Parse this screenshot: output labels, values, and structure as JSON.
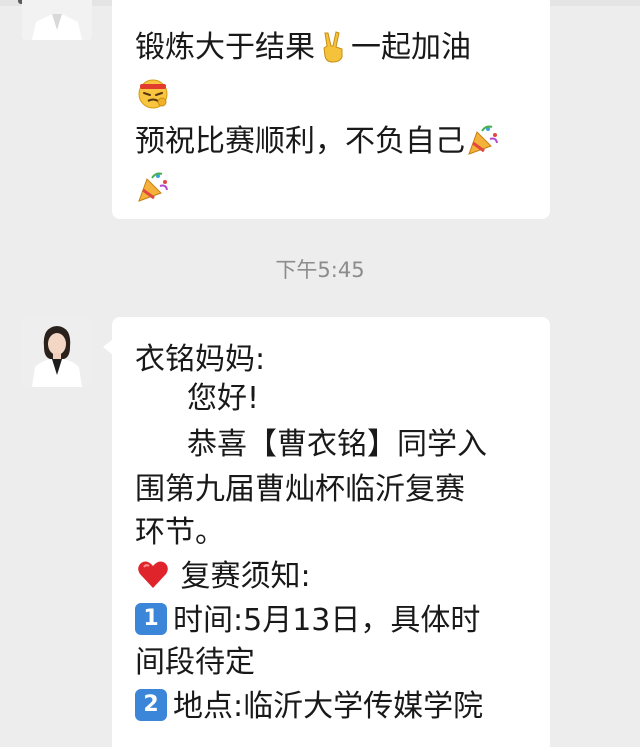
{
  "messages": [
    {
      "sender": "other",
      "lines": {
        "l1_text": "锻炼大于结果",
        "l1_emoji": "victory-hand-emoji",
        "l1_text2": "一起加油",
        "l2_emoji": "determined-face-headband-emoji",
        "l3_text": "预祝比赛顺利，不负自己",
        "l3_emoji": "party-popper-emoji",
        "l4_emoji": "party-popper-emoji"
      }
    }
  ],
  "timestamp": "下午5:45",
  "message2": {
    "greeting": "衣铭妈妈:",
    "hello": "您好!",
    "congrats_line1": "恭喜【曹衣铭】同学入",
    "congrats_line2": "围第九届曹灿杯临沂复赛",
    "congrats_line3": "环节。",
    "notice_icon": "red-heart-emoji",
    "notice_title": "复赛须知:",
    "item1_icon": "keycap-1-emoji",
    "item1_key": "1",
    "item1_line1": "时间:5月13日，具体时",
    "item1_line2": "间段待定",
    "item2_icon": "keycap-2-emoji",
    "item2_key": "2",
    "item2_line1": "地点:临沂大学传媒学院"
  },
  "colors": {
    "chat_background": "#ededed",
    "bubble_background": "#ffffff",
    "text": "#191919",
    "timestamp": "#8c8c8c",
    "keycap_blue": "#3b86d8",
    "heart_red": "#e0242c"
  }
}
